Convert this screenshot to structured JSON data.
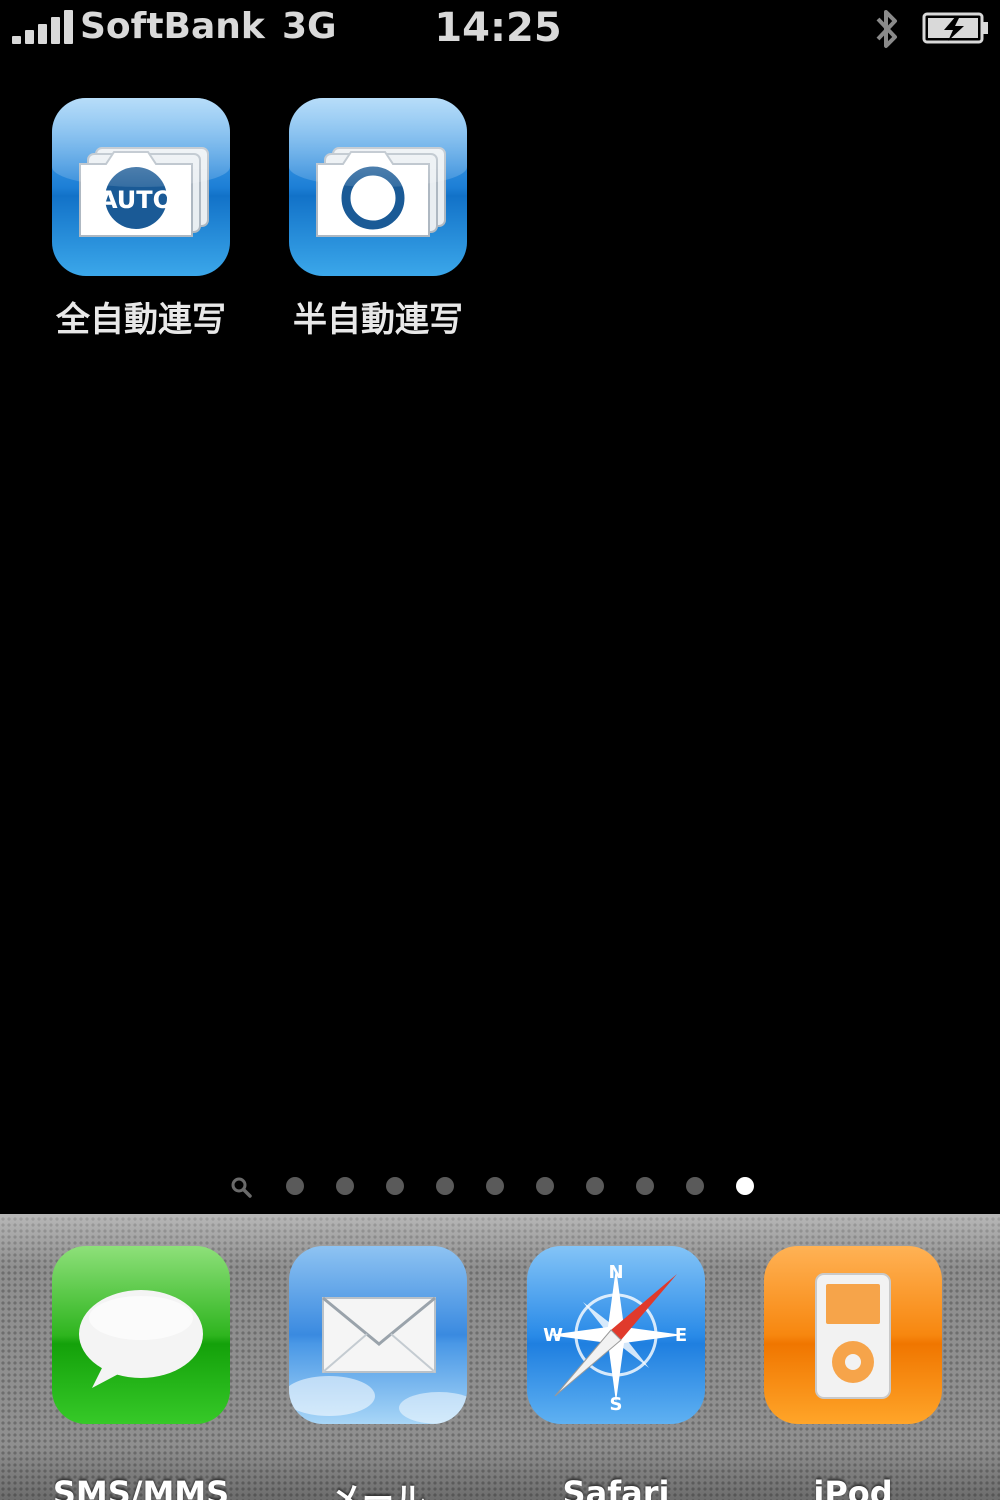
{
  "status_bar": {
    "carrier": "SoftBank",
    "network": "3G",
    "time": "14:25",
    "bluetooth_icon": "bluetooth-icon",
    "battery_icon": "battery-charging-icon"
  },
  "home_apps": [
    {
      "label": "全自動連写",
      "icon": "camera-auto-icon",
      "badge": "AUTO"
    },
    {
      "label": "半自動連写",
      "icon": "camera-manual-icon"
    }
  ],
  "page_indicator": {
    "total_pages": 10,
    "current_page": 10,
    "search_icon": "search-icon"
  },
  "dock": [
    {
      "label": "SMS/MMS",
      "icon": "speech-bubble-icon"
    },
    {
      "label": "メール",
      "icon": "envelope-icon"
    },
    {
      "label": "Safari",
      "icon": "compass-icon"
    },
    {
      "label": "iPod",
      "icon": "ipod-icon"
    }
  ],
  "colors": {
    "background": "#000000",
    "status_text": "#d9d9d9",
    "camera_icon_blue": "#1d7fd6",
    "sms_green": "#2fb51f",
    "ipod_orange": "#f7870f"
  }
}
